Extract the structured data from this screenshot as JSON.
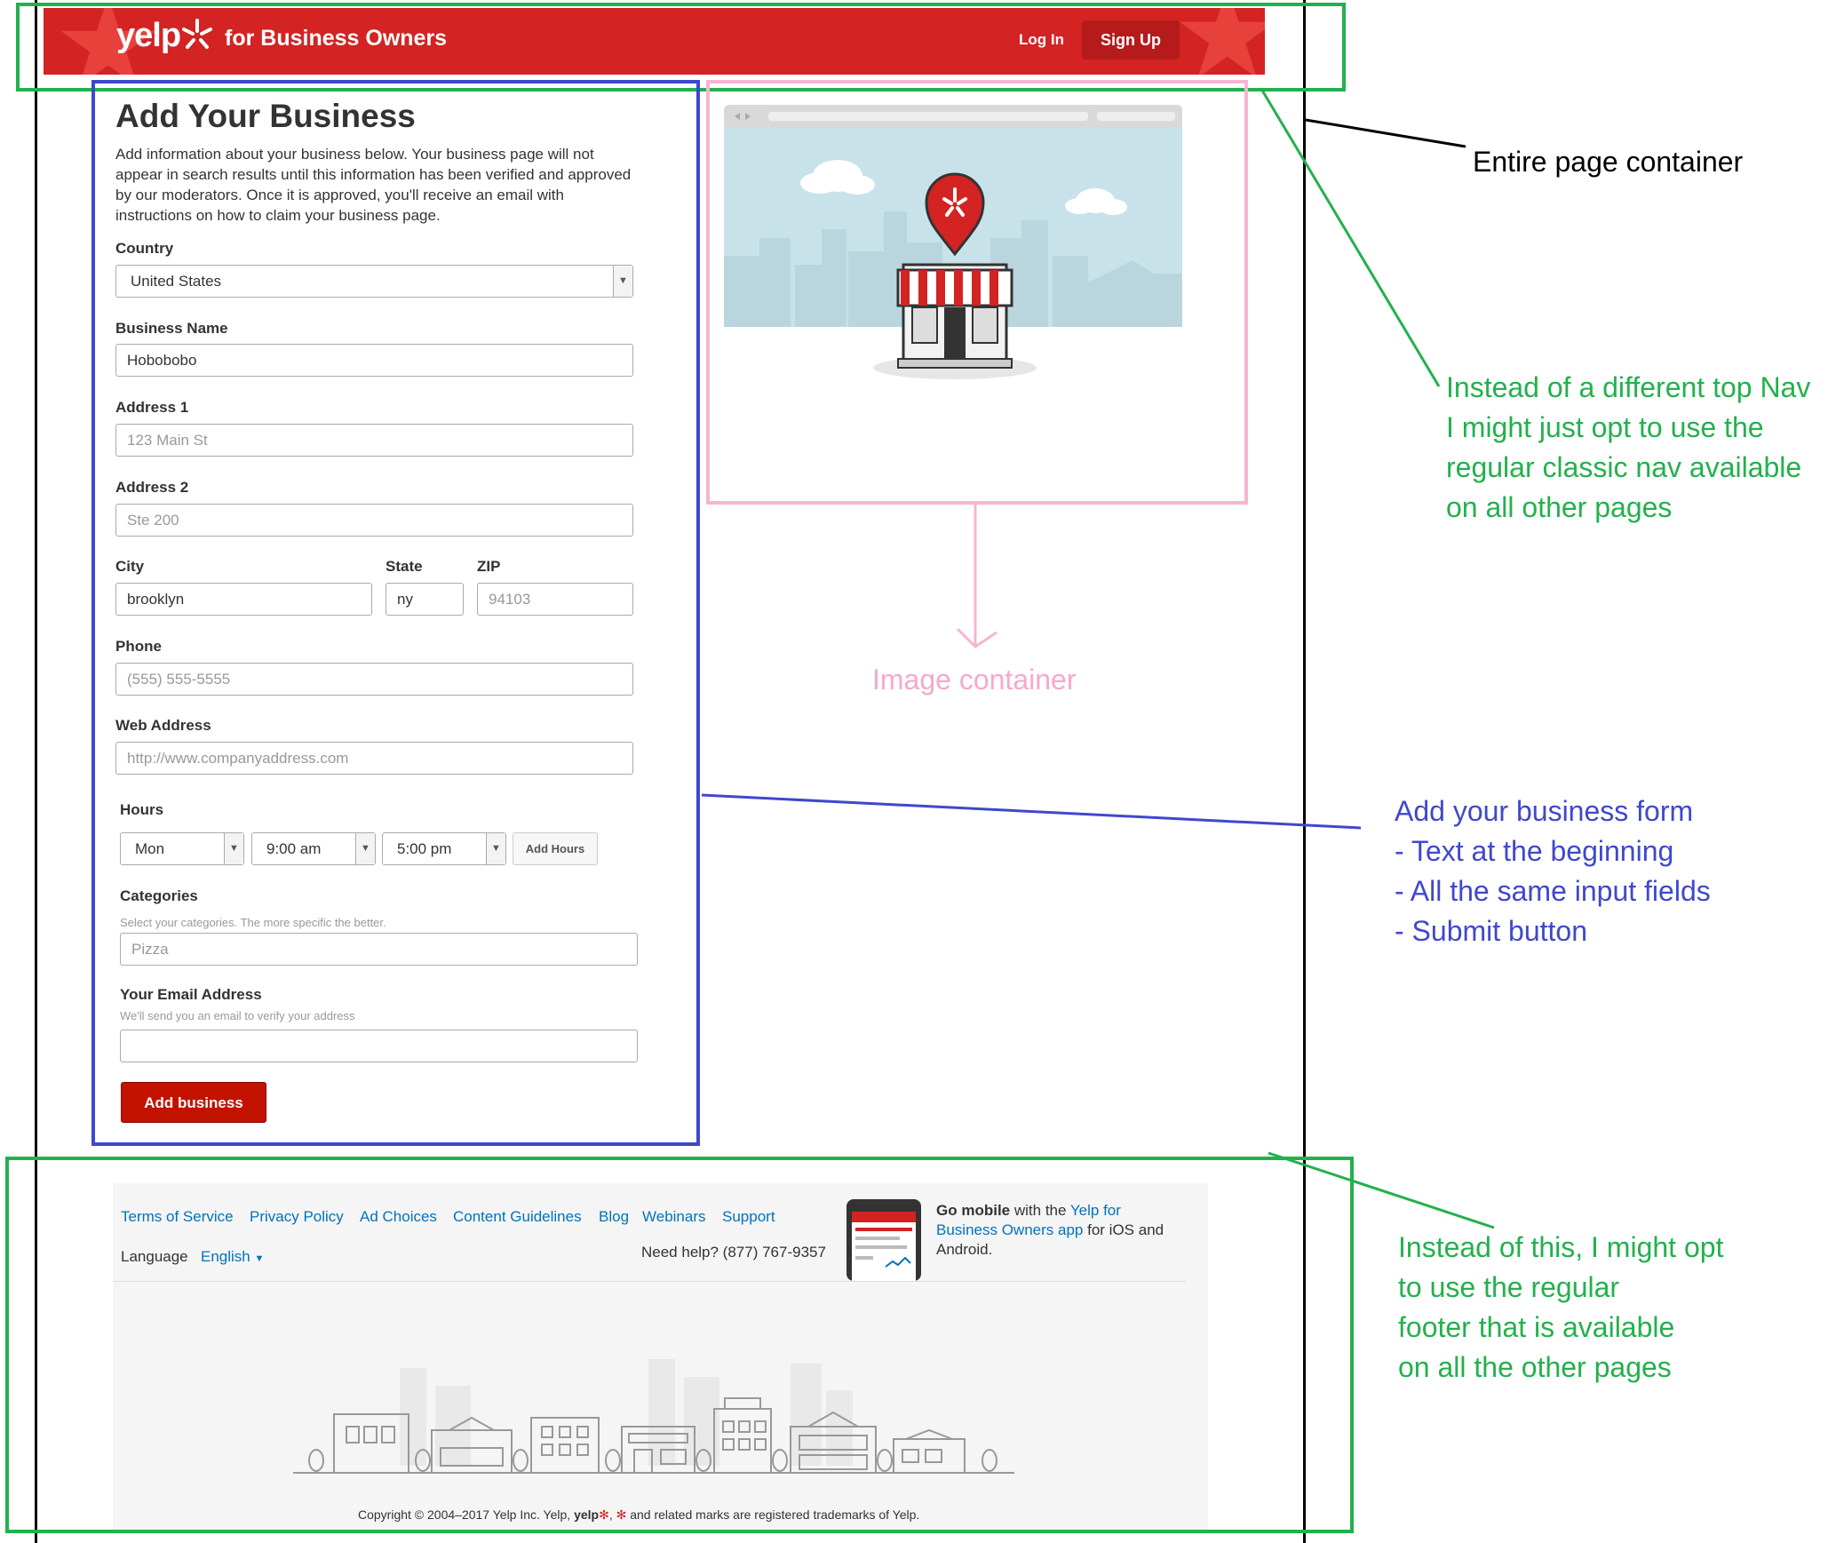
{
  "header": {
    "logo": "yelp",
    "tagline": "for Business Owners",
    "login": "Log In",
    "signup": "Sign Up"
  },
  "form": {
    "title": "Add Your Business",
    "intro": "Add information about your business below. Your business page will not appear in search results until this information has been verified and approved by our moderators. Once it is approved, you'll receive an email with instructions on how to claim your business page.",
    "country_label": "Country",
    "country_value": "United States",
    "business_name_label": "Business Name",
    "business_name_value": "Hobobobo",
    "address1_label": "Address 1",
    "address1_placeholder": "123 Main St",
    "address2_label": "Address 2",
    "address2_placeholder": "Ste 200",
    "city_label": "City",
    "city_value": "brooklyn",
    "state_label": "State",
    "state_value": "ny",
    "zip_label": "ZIP",
    "zip_placeholder": "94103",
    "phone_label": "Phone",
    "phone_placeholder": "(555) 555-5555",
    "web_label": "Web Address",
    "web_placeholder": "http://www.companyaddress.com",
    "hours_label": "Hours",
    "hours_day": "Mon",
    "hours_open": "9:00 am",
    "hours_close": "5:00 pm",
    "add_hours": "Add Hours",
    "categories_label": "Categories",
    "categories_hint": "Select your categories. The more specific the better.",
    "categories_placeholder": "Pizza",
    "email_label": "Your Email Address",
    "email_hint": "We'll send you an email to verify your address",
    "submit": "Add business"
  },
  "footer": {
    "links": [
      "Terms of Service",
      "Privacy Policy",
      "Ad Choices",
      "Content Guidelines",
      "Blog",
      "Webinars",
      "Support"
    ],
    "language_label": "Language",
    "language_value": "English",
    "help": "Need help? (877) 767-9357",
    "mobile_bold": "Go mobile",
    "mobile_with": "with the",
    "mobile_link1": "Yelp for",
    "mobile_link2": "Business Owners app",
    "mobile_tail1": "for iOS and",
    "mobile_tail2": "Android.",
    "copyright_pre": "Copyright © 2004–2017 Yelp Inc. Yelp,",
    "copyright_post": "and related marks are registered trademarks of Yelp."
  },
  "annotations": {
    "page_container": "Entire page container",
    "nav_note": [
      "Instead of a different top Nav",
      "I might just opt to use the",
      "regular classic nav available",
      "on all other pages"
    ],
    "image_container": "Image container",
    "form_note": [
      "Add your business form",
      "- Text at the beginning",
      "- All the same input fields",
      "- Submit button"
    ],
    "footer_note": [
      "Instead of this, I might opt",
      "to use the regular",
      "footer that is available",
      "on all the other pages"
    ]
  },
  "colors": {
    "brand_red": "#d32323",
    "link_blue": "#0073bb",
    "annotation_green": "#22b14c",
    "annotation_blue": "#3f48cc",
    "annotation_pink": "#f8b4d0"
  }
}
